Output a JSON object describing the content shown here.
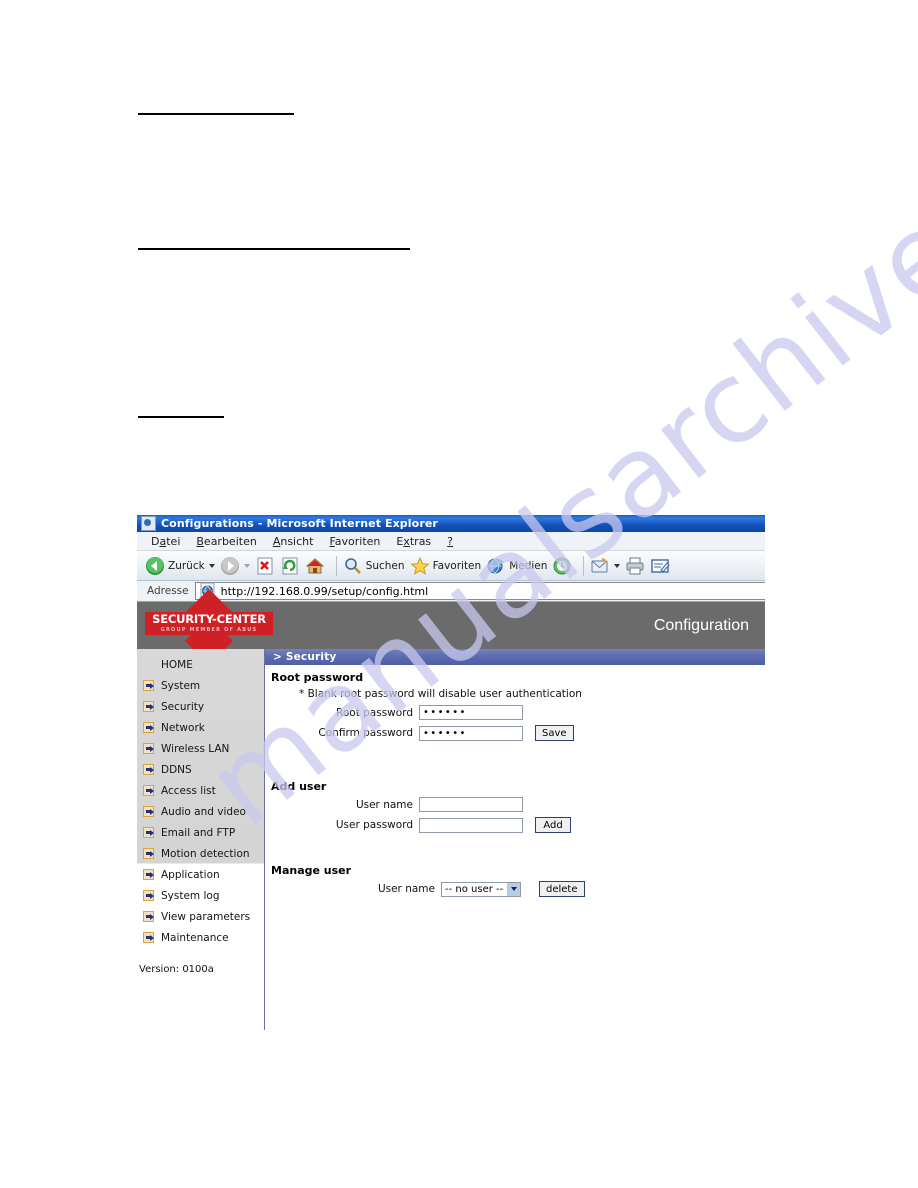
{
  "browser": {
    "title": "Configurations - Microsoft Internet Explorer",
    "title_icon": "ie-page-icon",
    "menu": [
      {
        "pre": "D",
        "acc": "a",
        "post": "tei"
      },
      {
        "pre": "",
        "acc": "B",
        "post": "earbeiten"
      },
      {
        "pre": "",
        "acc": "A",
        "post": "nsicht"
      },
      {
        "pre": "",
        "acc": "F",
        "post": "avoriten"
      },
      {
        "pre": "E",
        "acc": "x",
        "post": "tras"
      },
      {
        "pre": "",
        "acc": "?",
        "post": ""
      }
    ],
    "toolbar": {
      "back_label": "Zurück",
      "search_label": "Suchen",
      "favorites_label": "Favoriten",
      "media_label": "Medien"
    },
    "address": {
      "label": "Adresse",
      "url": "http://192.168.0.99/setup/config.html"
    }
  },
  "device": {
    "brand": {
      "name": "SECURITY-CENTER",
      "tagline": "GROUP MEMBER OF ABUS"
    },
    "header_title": "Configuration",
    "sidebar": {
      "items": [
        {
          "label": "HOME",
          "bullet": false
        },
        {
          "label": "System",
          "bullet": true
        },
        {
          "label": "Security",
          "bullet": true
        },
        {
          "label": "Network",
          "bullet": true
        },
        {
          "label": "Wireless LAN",
          "bullet": true
        },
        {
          "label": "DDNS",
          "bullet": true
        },
        {
          "label": "Access list",
          "bullet": true
        },
        {
          "label": "Audio and video",
          "bullet": true
        },
        {
          "label": "Email and FTP",
          "bullet": true
        },
        {
          "label": "Motion detection",
          "bullet": true
        },
        {
          "label": "Application",
          "bullet": true
        },
        {
          "label": "System log",
          "bullet": true
        },
        {
          "label": "View parameters",
          "bullet": true
        },
        {
          "label": "Maintenance",
          "bullet": true
        }
      ],
      "version": "Version: 0100a"
    },
    "section_bar": "> Security",
    "root_password": {
      "heading": "Root password",
      "note": "* Blank root password will disable user authentication",
      "root_label": "Root password",
      "root_value": "••••••",
      "confirm_label": "Confirm password",
      "confirm_value": "••••••",
      "save_label": "Save"
    },
    "add_user": {
      "heading": "Add user",
      "name_label": "User name",
      "name_value": "",
      "password_label": "User password",
      "password_value": "",
      "add_label": "Add"
    },
    "manage_user": {
      "heading": "Manage user",
      "name_label": "User name",
      "selected": "-- no user --",
      "delete_label": "delete"
    }
  },
  "page": {
    "watermark": "manualsarchive.com"
  },
  "colors": {
    "title_bar": "#1450b8",
    "device_header": "#6b6b6b",
    "section_bar": "#5d6cae",
    "brand_red": "#cf2026",
    "sidebar": "#d4d4d4"
  }
}
